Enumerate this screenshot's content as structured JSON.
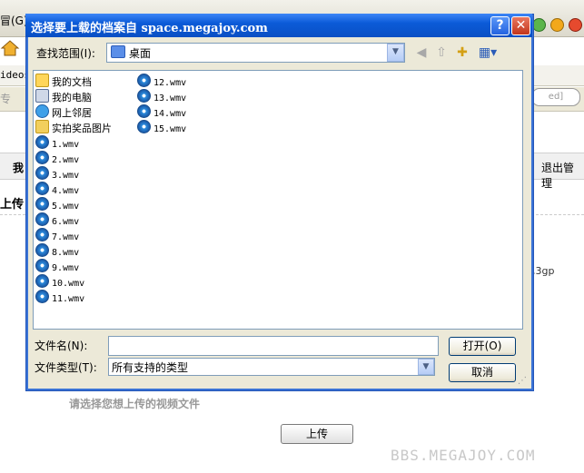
{
  "background": {
    "menu_fragment": "冒(G)",
    "address_fragment": "ideos",
    "search_fragment": "专",
    "right_search_fragment": "ed]",
    "nav_left": "我",
    "nav_right": "退出管理",
    "upload_heading": "上传",
    "format_text": ",3gp",
    "hint_text": "请选择您想上传的视频文件",
    "upload_button_label": "上传",
    "watermark": "BBS.MEGAJOY.COM"
  },
  "dialog": {
    "title": "选择要上载的档案自 space.megajoy.com",
    "help_label": "?",
    "close_label": "✕",
    "look_in_label": "查找范围(I):",
    "look_in_value": "桌面",
    "files_column1": [
      {
        "name": "我的文档",
        "icon": "my-documents-icon"
      },
      {
        "name": "我的电脑",
        "icon": "my-computer-icon"
      },
      {
        "name": "网上邻居",
        "icon": "network-places-icon"
      },
      {
        "name": "实拍奖品图片",
        "icon": "folder-icon"
      },
      {
        "name": "1.wmv",
        "icon": "wmv-file-icon"
      },
      {
        "name": "2.wmv",
        "icon": "wmv-file-icon"
      },
      {
        "name": "3.wmv",
        "icon": "wmv-file-icon"
      },
      {
        "name": "4.wmv",
        "icon": "wmv-file-icon"
      },
      {
        "name": "5.wmv",
        "icon": "wmv-file-icon"
      },
      {
        "name": "6.wmv",
        "icon": "wmv-file-icon"
      },
      {
        "name": "7.wmv",
        "icon": "wmv-file-icon"
      },
      {
        "name": "8.wmv",
        "icon": "wmv-file-icon"
      },
      {
        "name": "9.wmv",
        "icon": "wmv-file-icon"
      },
      {
        "name": "10.wmv",
        "icon": "wmv-file-icon"
      },
      {
        "name": "11.wmv",
        "icon": "wmv-file-icon"
      }
    ],
    "files_column2": [
      {
        "name": "12.wmv",
        "icon": "wmv-file-icon"
      },
      {
        "name": "13.wmv",
        "icon": "wmv-file-icon"
      },
      {
        "name": "14.wmv",
        "icon": "wmv-file-icon"
      },
      {
        "name": "15.wmv",
        "icon": "wmv-file-icon"
      }
    ],
    "filename_label": "文件名(N):",
    "filename_value": "",
    "filetype_label": "文件类型(T):",
    "filetype_value": "所有支持的类型",
    "open_label": "打开(O)",
    "cancel_label": "取消"
  }
}
